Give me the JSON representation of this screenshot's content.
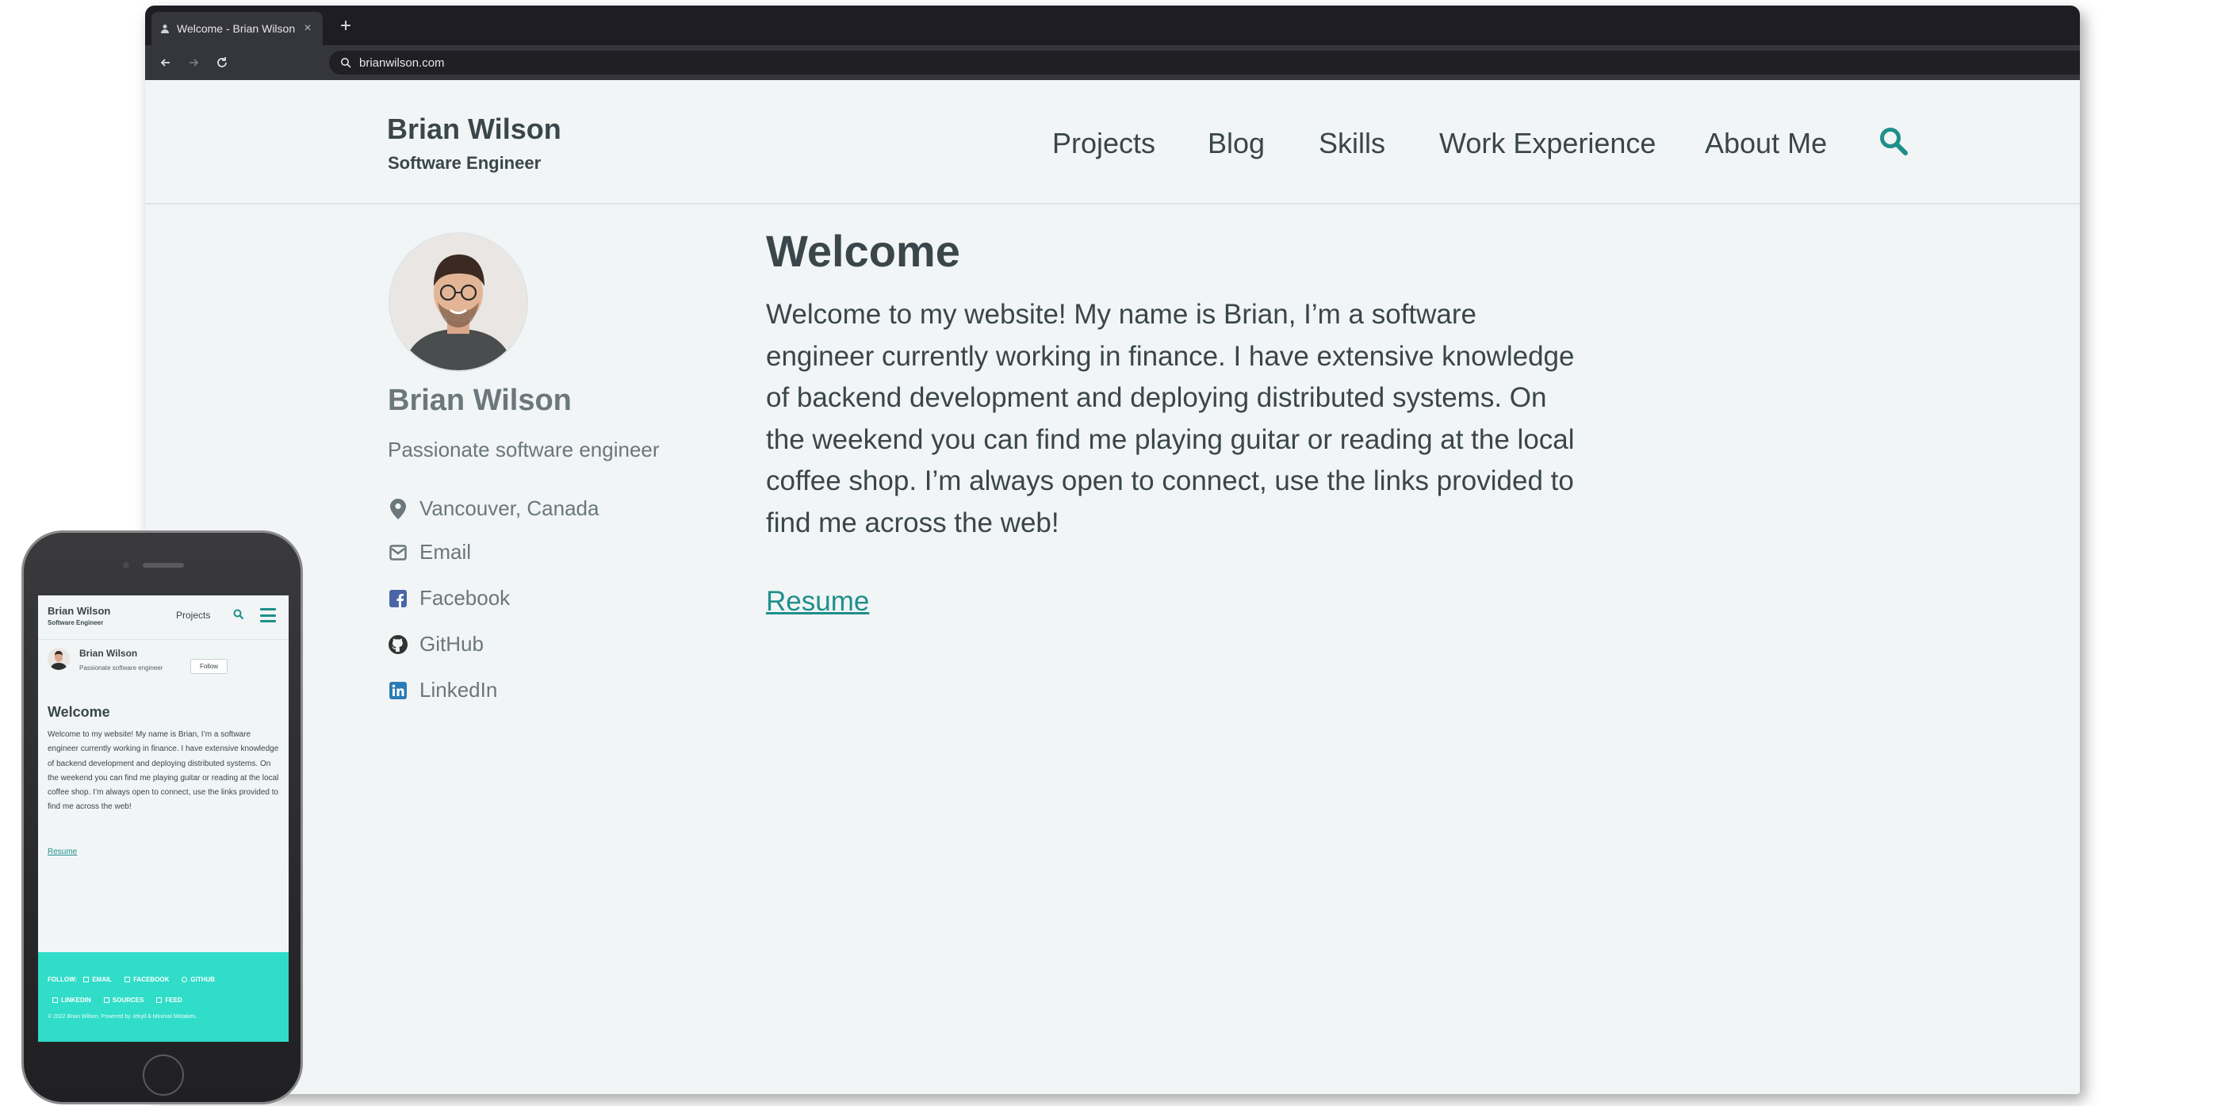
{
  "browser": {
    "tab_title": "Welcome - Brian Wilson",
    "new_tab": "+",
    "close_tab": "×",
    "url": "brianwilson.com"
  },
  "site": {
    "brand_name": "Brian Wilson",
    "brand_tagline": "Software Engineer",
    "nav": [
      "Projects",
      "Blog",
      "Skills",
      "Work Experience",
      "About Me"
    ],
    "accent_color": "#1f8f8a"
  },
  "sidebar": {
    "name": "Brian Wilson",
    "bio": "Passionate software engineer",
    "links": [
      {
        "label": "Vancouver, Canada",
        "icon": "location-pin-icon"
      },
      {
        "label": "Email",
        "icon": "email-icon"
      },
      {
        "label": "Facebook",
        "icon": "facebook-icon"
      },
      {
        "label": "GitHub",
        "icon": "github-icon"
      },
      {
        "label": "LinkedIn",
        "icon": "linkedin-icon"
      }
    ]
  },
  "main": {
    "title": "Welcome",
    "body": "Welcome to my website! My name is Brian, I’m a software engineer currently working in finance. I have extensive knowledge of backend development and deploying distributed systems. On the weekend you can find me playing guitar or reading at the local coffee shop. I’m always open to connect, use the links provided to find me across the web!",
    "resume_label": "Resume"
  },
  "mobile": {
    "brand_name": "Brian Wilson",
    "brand_tagline": "Software Engineer",
    "nav_item": "Projects",
    "author_name": "Brian Wilson",
    "author_bio": "Passionate software engineer",
    "follow_label": "Follow",
    "welcome_title": "Welcome",
    "welcome_body": "Welcome to my website! My name is Brian, I’m a software engineer currently working in finance. I have extensive knowledge of backend development and deploying distributed systems. On the weekend you can find me playing guitar or reading at the local coffee shop. I’m always open to connect, use the links provided to find me across the web!",
    "resume_label": "Resume",
    "footer": {
      "follow_label": "FOLLOW:",
      "row1": [
        "EMAIL",
        "FACEBOOK",
        "GITHUB"
      ],
      "row2": [
        "LINKEDIN",
        "SOURCES",
        "FEED"
      ],
      "copyright": "© 2022 Brian Wilson. Powered by Jekyll & Minimal Mistakes.",
      "color": "#2fddc8"
    }
  }
}
